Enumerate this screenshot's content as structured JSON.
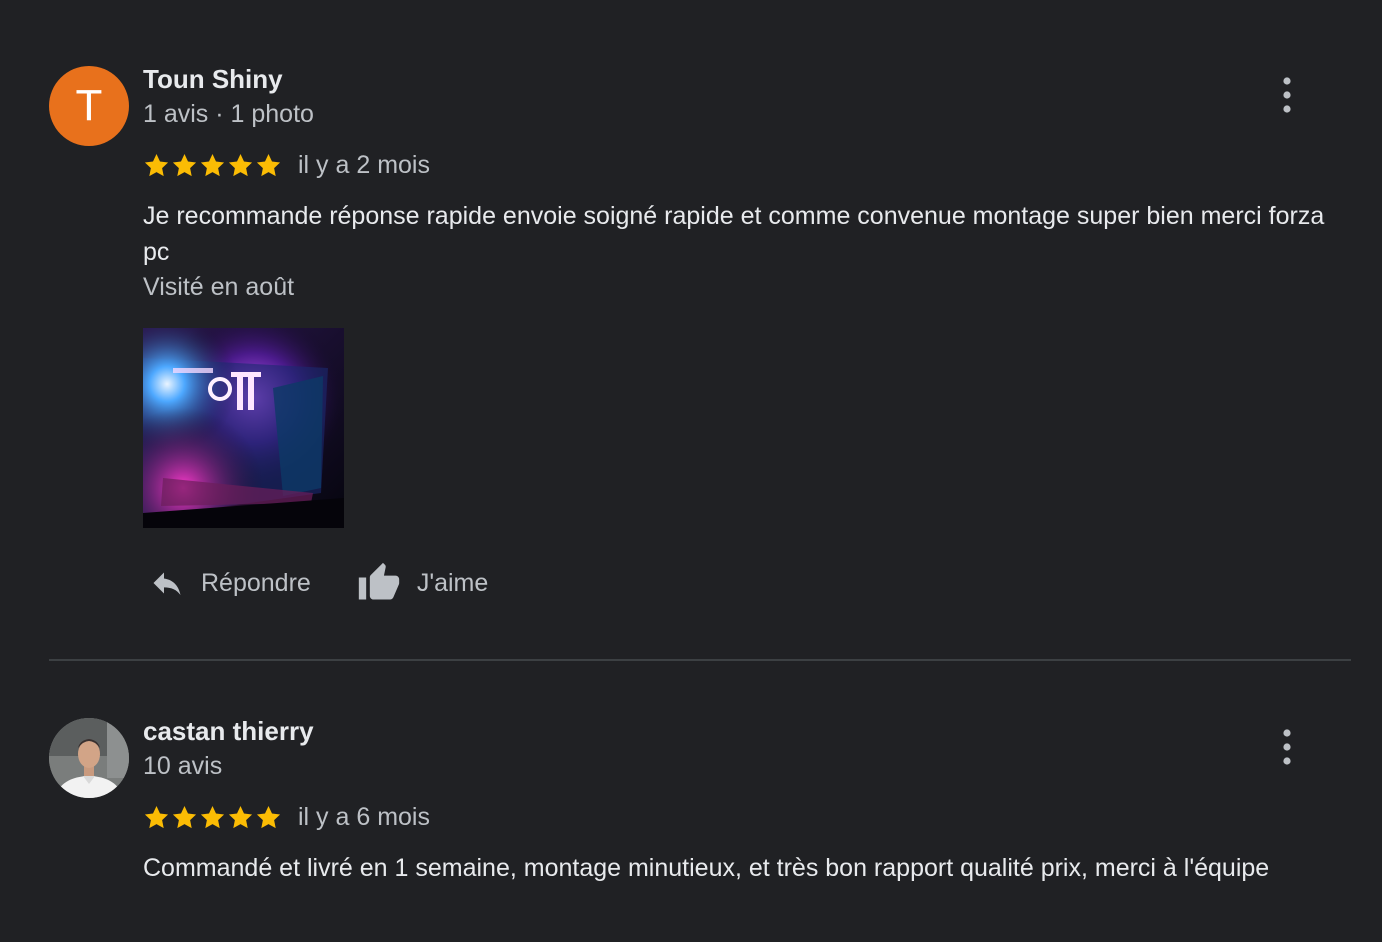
{
  "reviews": [
    {
      "avatar_letter": "T",
      "avatar_color": "#e8711c",
      "name": "Toun Shiny",
      "meta": "1 avis · 1 photo",
      "stars": 5,
      "time": "il y a 2 mois",
      "text": "Je recommande réponse rapide envoie soigné rapide et comme convenue montage super bien merci forza pc",
      "visited": "Visité en août",
      "actions": {
        "reply": "Répondre",
        "like": "J'aime"
      }
    },
    {
      "name": "castan thierry",
      "meta": "10 avis",
      "stars": 5,
      "time": "il y a 6 mois",
      "text": "Commandé et livré en 1 semaine, montage minutieux, et très bon rapport qualité prix, merci à l'équipe"
    }
  ],
  "colors": {
    "background": "#202124",
    "star": "#fbbc04",
    "secondary_text": "#bdc1c6",
    "primary_text": "#e8eaed",
    "divider": "#3c4043"
  },
  "icons": {
    "more": "more-vert-icon",
    "reply": "reply-icon",
    "like": "thumb-up-icon",
    "star": "star-icon"
  }
}
